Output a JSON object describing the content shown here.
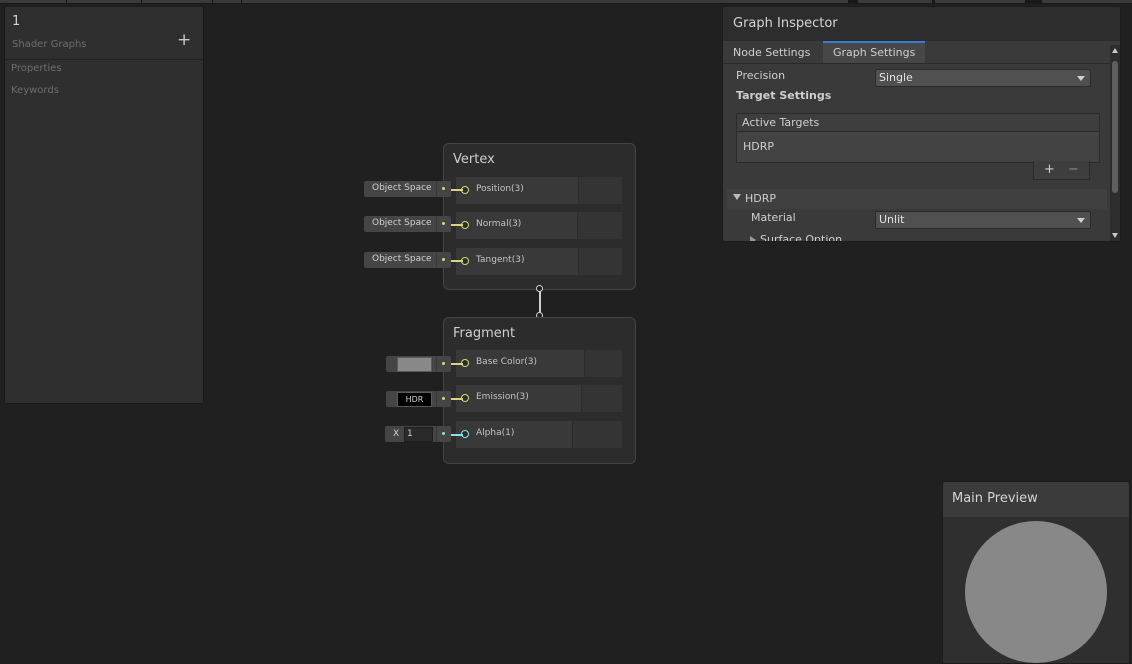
{
  "blackboard": {
    "title": "1",
    "subtitle": "Shader Graphs",
    "add_label": "+",
    "sections": [
      "Properties",
      "Keywords"
    ]
  },
  "vertex": {
    "title": "Vertex",
    "slots": [
      {
        "label": "Position(3)",
        "input": "Object Space"
      },
      {
        "label": "Normal(3)",
        "input": "Object Space"
      },
      {
        "label": "Tangent(3)",
        "input": "Object Space"
      }
    ]
  },
  "fragment": {
    "title": "Fragment",
    "slots": [
      {
        "label": "Base Color(3)",
        "input_color": "#888888"
      },
      {
        "label": "Emission(3)",
        "input": "HDR",
        "input_color": "#000000"
      },
      {
        "label": "Alpha(1)",
        "input_axis": "X",
        "input_value": "1"
      }
    ]
  },
  "inspector": {
    "title": "Graph Inspector",
    "tabs": [
      "Node Settings",
      "Graph Settings"
    ],
    "active_tab": "Graph Settings",
    "precision_label": "Precision",
    "precision_value": "Single",
    "target_settings": "Target Settings",
    "active_targets_label": "Active Targets",
    "targets": [
      "HDRP"
    ],
    "add_label": "+",
    "remove_label": "−",
    "hdrp_section": "HDRP",
    "material_label": "Material",
    "material_value": "Unlit",
    "surface_options": "Surface Option"
  },
  "preview": {
    "title": "Main Preview",
    "sphere_color": "#888888"
  },
  "colors": {
    "port_vector": "#d8d67a",
    "port_float": "#84e4e7",
    "tab_accent": "#3a7ad0"
  }
}
